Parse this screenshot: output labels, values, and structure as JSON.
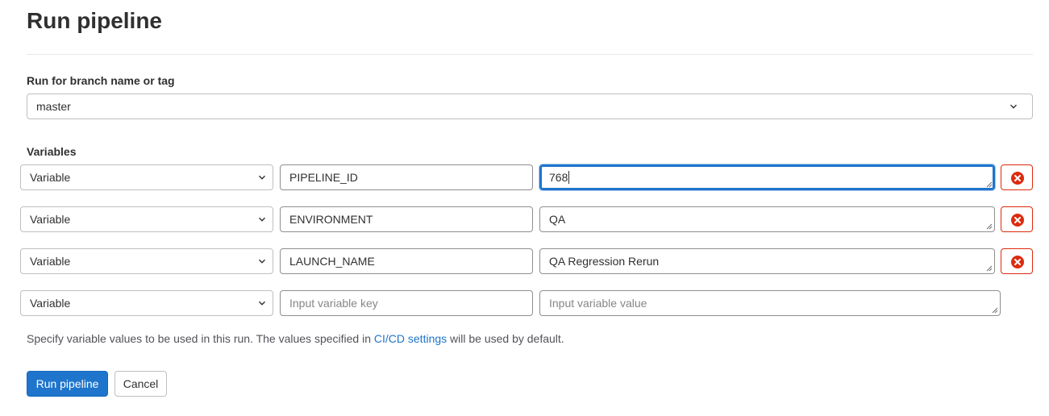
{
  "page": {
    "title": "Run pipeline"
  },
  "branch": {
    "label": "Run for branch name or tag",
    "value": "master"
  },
  "variables": {
    "label": "Variables",
    "rows": [
      {
        "type": "Variable",
        "key": "PIPELINE_ID",
        "value": "768"
      },
      {
        "type": "Variable",
        "key": "ENVIRONMENT",
        "value": "QA"
      },
      {
        "type": "Variable",
        "key": "LAUNCH_NAME",
        "value": "QA Regression Rerun"
      }
    ],
    "new_row": {
      "type": "Variable",
      "key_placeholder": "Input variable key",
      "value_placeholder": "Input variable value"
    }
  },
  "help": {
    "before": "Specify variable values to be used in this run. The values specified in ",
    "link": "CI/CD settings",
    "after": " will be used by default."
  },
  "actions": {
    "run_label": "Run pipeline",
    "cancel_label": "Cancel"
  },
  "colors": {
    "primary": "#1f75cb",
    "danger": "#dd2b0e",
    "text": "#303030"
  },
  "icons": {
    "dropdown": "chevron-down-icon",
    "remove": "remove-circle-icon"
  }
}
